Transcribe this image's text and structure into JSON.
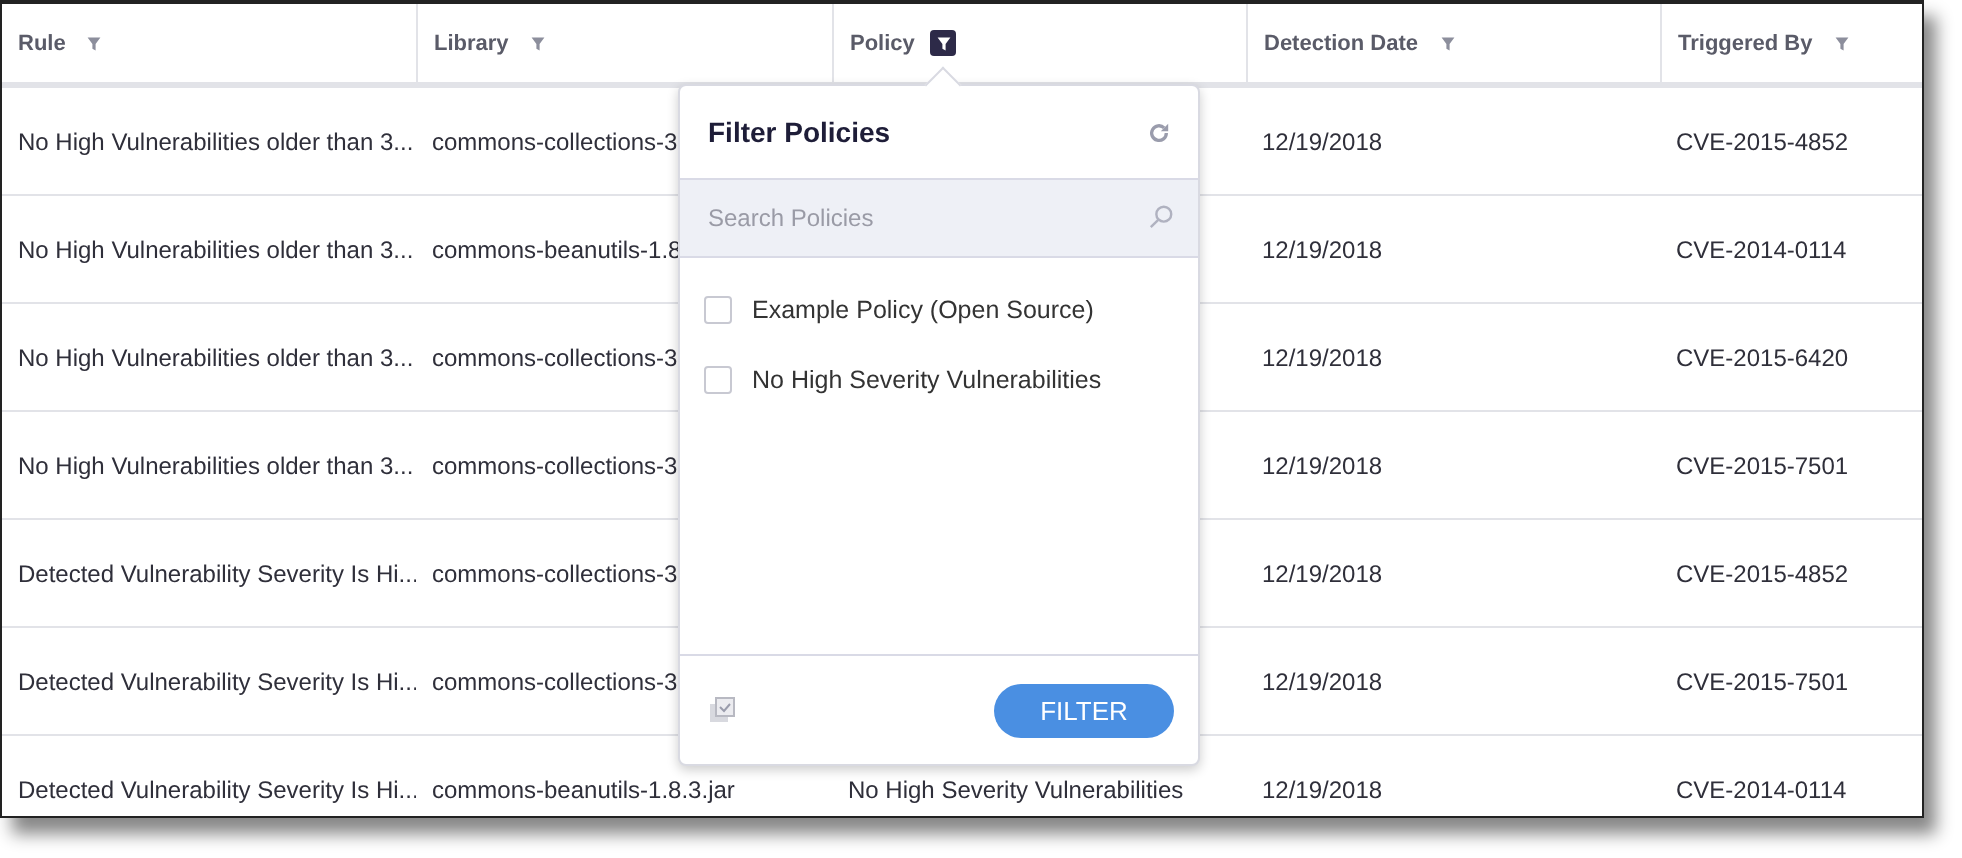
{
  "table": {
    "columns": [
      {
        "label": "Rule",
        "filter_active": false
      },
      {
        "label": "Library",
        "filter_active": false
      },
      {
        "label": "Policy",
        "filter_active": true
      },
      {
        "label": "Detection Date",
        "filter_active": false
      },
      {
        "label": "Triggered By",
        "filter_active": false
      }
    ],
    "rows": [
      {
        "rule": "No High Vulnerabilities older than 3...",
        "library": "commons-collections-3",
        "date": "12/19/2018",
        "triggered_by": "CVE-2015-4852"
      },
      {
        "rule": "No High Vulnerabilities older than 3...",
        "library": "commons-beanutils-1.8",
        "date": "12/19/2018",
        "triggered_by": "CVE-2014-0114"
      },
      {
        "rule": "No High Vulnerabilities older than 3...",
        "library": "commons-collections-3",
        "date": "12/19/2018",
        "triggered_by": "CVE-2015-6420"
      },
      {
        "rule": "No High Vulnerabilities older than 3...",
        "library": "commons-collections-3",
        "date": "12/19/2018",
        "triggered_by": "CVE-2015-7501"
      },
      {
        "rule": "Detected Vulnerability Severity Is Hi...",
        "library": "commons-collections-3",
        "date": "12/19/2018",
        "triggered_by": "CVE-2015-4852"
      },
      {
        "rule": "Detected Vulnerability Severity Is Hi...",
        "library": "commons-collections-3",
        "date": "12/19/2018",
        "triggered_by": "CVE-2015-7501"
      },
      {
        "rule": "Detected Vulnerability Severity Is Hi...",
        "library": "commons-beanutils-1.8.3.jar",
        "policy": "No High Severity Vulnerabilities",
        "date": "12/19/2018",
        "triggered_by": "CVE-2014-0114"
      }
    ]
  },
  "filter_popup": {
    "title": "Filter Policies",
    "search": {
      "placeholder": "Search Policies"
    },
    "options": [
      {
        "label": "Example Policy (Open Source)",
        "checked": false
      },
      {
        "label": "No High Severity Vulnerabilities",
        "checked": false
      }
    ],
    "button": "FILTER"
  }
}
